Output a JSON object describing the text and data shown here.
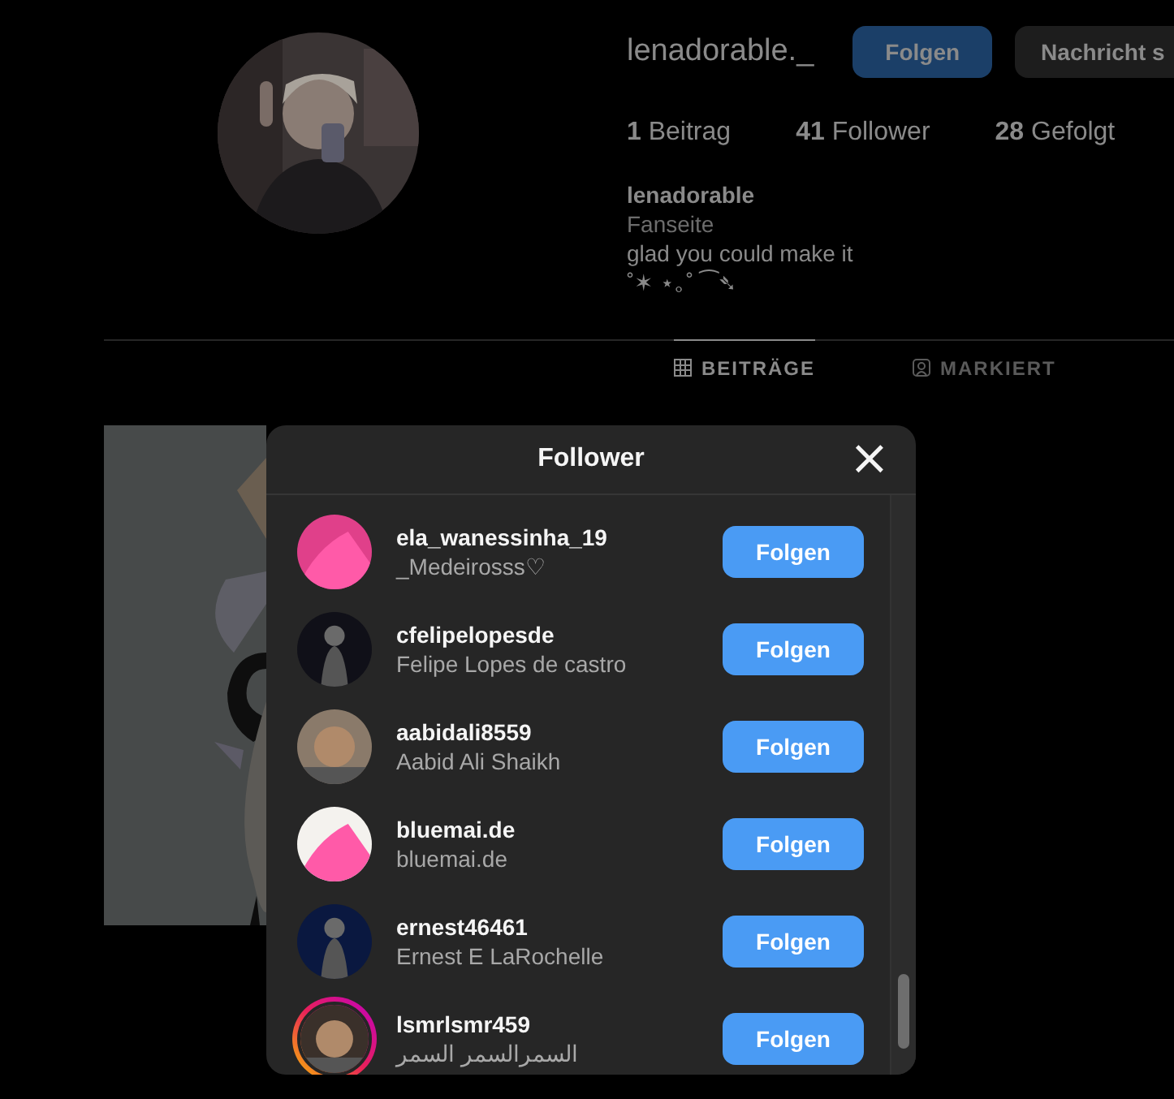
{
  "profile": {
    "username": "lenadorable._",
    "follow_button": "Folgen",
    "message_button": "Nachricht s",
    "stats": [
      {
        "count": "1",
        "label": "Beitrag"
      },
      {
        "count": "41",
        "label": "Follower"
      },
      {
        "count": "28",
        "label": "Gefolgt"
      }
    ],
    "name": "lenadorable",
    "category": "Fanseite",
    "bio": [
      "glad you could make it",
      "˚✶ ⋆｡˚ ⁀➴"
    ]
  },
  "tabs": [
    {
      "label": "BEITRÄGE",
      "kind": "grid",
      "selected": true
    },
    {
      "label": "MARKIERT",
      "kind": "tagged",
      "selected": false
    }
  ],
  "dialog": {
    "title": "Follower",
    "close": "×",
    "followers": [
      {
        "username": "ela_wanessinha_19",
        "name": "_Medeirosss♡",
        "button": "Folgen",
        "story_ring": false,
        "color": "#e0408a"
      },
      {
        "username": "cfelipelopesde",
        "name": "Felipe Lopes de castro",
        "button": "Folgen",
        "story_ring": false,
        "color": "#101018"
      },
      {
        "username": "aabidali8559",
        "name": "Aabid Ali Shaikh",
        "button": "Folgen",
        "story_ring": false,
        "color": "#8a7a6a"
      },
      {
        "username": "bluemai.de",
        "name": "bluemai.de",
        "button": "Folgen",
        "story_ring": false,
        "color": "#f4f2ee"
      },
      {
        "username": "ernest46461",
        "name": "Ernest E LaRochelle",
        "button": "Folgen",
        "story_ring": false,
        "color": "#0a1840"
      },
      {
        "username": "lsmrlsmr459",
        "name": "السمرالسمر السمر",
        "button": "Folgen",
        "story_ring": true,
        "color": "#3a302a"
      }
    ]
  }
}
